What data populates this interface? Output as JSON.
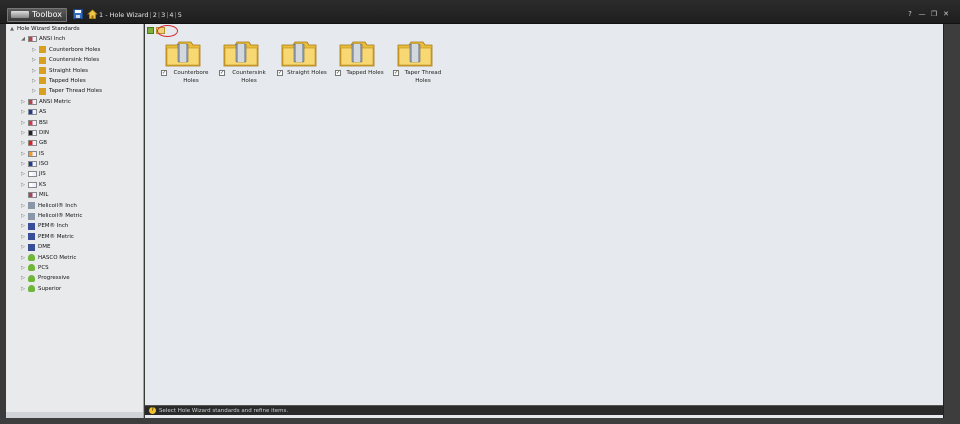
{
  "app": {
    "title": "Toolbox"
  },
  "breadcrumb": [
    "1 - Hole Wizard",
    "2",
    "3",
    "4",
    "5"
  ],
  "tree": [
    {
      "label": "Hole Wizard Standards",
      "level": 0,
      "expander": "▲",
      "icon": "none"
    },
    {
      "label": "ANSI Inch",
      "level": 1,
      "expander": "◢",
      "icon": "flag",
      "color": "#b04848"
    },
    {
      "label": "Counterbore Holes",
      "level": 2,
      "expander": "▷",
      "icon": "hole"
    },
    {
      "label": "Countersink Holes",
      "level": 2,
      "expander": "▷",
      "icon": "hole"
    },
    {
      "label": "Straight Holes",
      "level": 2,
      "expander": "▷",
      "icon": "hole"
    },
    {
      "label": "Tapped Holes",
      "level": 2,
      "expander": "▷",
      "icon": "hole"
    },
    {
      "label": "Taper Thread Holes",
      "level": 2,
      "expander": "▷",
      "icon": "hole"
    },
    {
      "label": "ANSI Metric",
      "level": 1,
      "expander": "▷",
      "icon": "flag",
      "color": "#b04848"
    },
    {
      "label": "AS",
      "level": 1,
      "expander": "▷",
      "icon": "flag",
      "color": "#1e3d8f"
    },
    {
      "label": "BSI",
      "level": 1,
      "expander": "▷",
      "icon": "flag",
      "color": "#c8404a"
    },
    {
      "label": "DIN",
      "level": 1,
      "expander": "▷",
      "icon": "flag",
      "color": "#222222"
    },
    {
      "label": "GB",
      "level": 1,
      "expander": "▷",
      "icon": "flag",
      "color": "#d8261c"
    },
    {
      "label": "IS",
      "level": 1,
      "expander": "▷",
      "icon": "flag",
      "color": "#f2992e"
    },
    {
      "label": "ISO",
      "level": 1,
      "expander": "▷",
      "icon": "flag",
      "color": "#1e3c8a"
    },
    {
      "label": "JIS",
      "level": 1,
      "expander": "▷",
      "icon": "flag",
      "color": "#ffffff"
    },
    {
      "label": "KS",
      "level": 1,
      "expander": "▷",
      "icon": "flag",
      "color": "#ffffff"
    },
    {
      "label": "MIL",
      "level": 1,
      "expander": "",
      "icon": "flag",
      "color": "#a04858"
    },
    {
      "label": "Helicoil® Inch",
      "level": 1,
      "expander": "▷",
      "icon": "coil"
    },
    {
      "label": "Helicoil® Metric",
      "level": 1,
      "expander": "▷",
      "icon": "coil"
    },
    {
      "label": "PEM® Inch",
      "level": 1,
      "expander": "▷",
      "icon": "pem"
    },
    {
      "label": "PEM® Metric",
      "level": 1,
      "expander": "▷",
      "icon": "pem"
    },
    {
      "label": "DME",
      "level": 1,
      "expander": "▷",
      "icon": "dme"
    },
    {
      "label": "HASCO Metric",
      "level": 1,
      "expander": "▷",
      "icon": "person"
    },
    {
      "label": "PCS",
      "level": 1,
      "expander": "▷",
      "icon": "person"
    },
    {
      "label": "Progressive",
      "level": 1,
      "expander": "▷",
      "icon": "person"
    },
    {
      "label": "Superior",
      "level": 1,
      "expander": "▷",
      "icon": "person"
    }
  ],
  "folders": [
    {
      "label": "Counterbore Holes",
      "checked": "✓"
    },
    {
      "label": "Countersink Holes",
      "checked": "✓"
    },
    {
      "label": "Straight Holes",
      "checked": "✓"
    },
    {
      "label": "Tapped Holes",
      "checked": "✓"
    },
    {
      "label": "Taper Thread Holes",
      "checked": "✓"
    }
  ],
  "status": {
    "text": "Select Hole Wizard standards and refine items."
  },
  "icons": {
    "save": "save-icon",
    "home": "home-icon",
    "help": "help-icon",
    "minimize": "minimize-icon",
    "restore": "restore-icon",
    "close": "close-icon"
  },
  "window_controls": {
    "help": "?",
    "minimize": "—",
    "restore": "❐",
    "close": "✕"
  }
}
